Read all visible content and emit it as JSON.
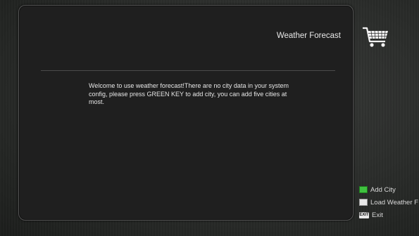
{
  "header": {
    "title": "Weather Forecast",
    "icon": "cart-icon"
  },
  "main": {
    "message": "Welcome to use weather forecast!There are no city data in your system config, please press GREEN KEY to add city, you can add five cities at most."
  },
  "legend": {
    "items": [
      {
        "key_color": "#3fc23f",
        "label": "Add City"
      },
      {
        "key_color": "#e8e8e8",
        "label": "Load Weather F"
      },
      {
        "key_label": "EXIT",
        "label": "Exit"
      }
    ]
  }
}
